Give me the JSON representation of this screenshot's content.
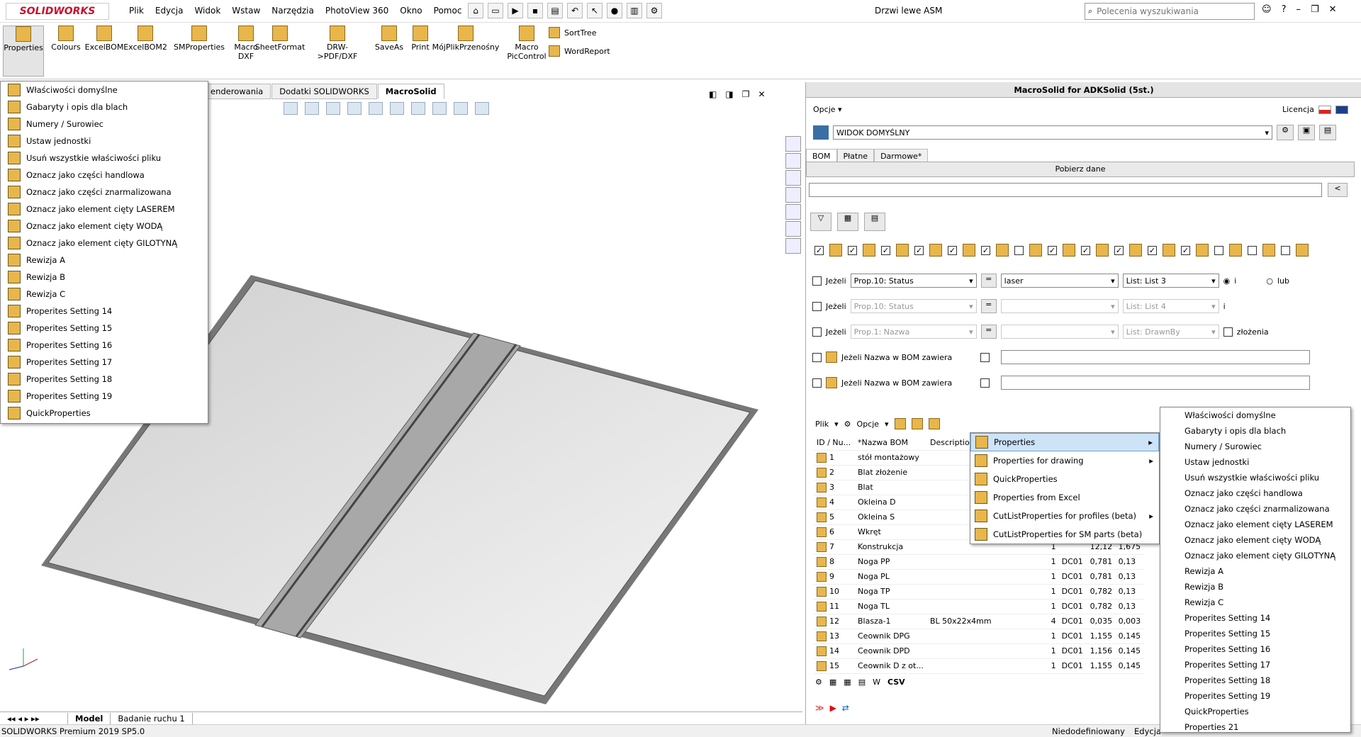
{
  "app": {
    "logo": "SOLIDWORKS",
    "window_title": "Drzwi lewe ASM"
  },
  "menu": [
    "Plik",
    "Edycja",
    "Widok",
    "Wstaw",
    "Narzędzia",
    "PhotoView 360",
    "Okno",
    "Pomoc"
  ],
  "search": {
    "placeholder": "Polecenia wyszukiwania"
  },
  "ribbon": {
    "buttons": [
      "Properties",
      "Colours",
      "ExcelBOM",
      "ExcelBOM2",
      "SMProperties",
      "Macro DXF",
      "SheetFormat",
      "DRW->PDF/DXF",
      "SaveAs",
      "Print",
      "MójPlikPrzenośny",
      "Macro PicControl"
    ],
    "small": [
      "SortTree",
      "WordReport"
    ]
  },
  "tabs": [
    "enderowania",
    "Dodatki SOLIDWORKS",
    "MacroSolid"
  ],
  "left_menu": [
    "Właściwości domyślne",
    "Gabaryty i opis dla blach",
    "Numery / Surowiec",
    "Ustaw jednostki",
    "Usuń wszystkie właściwości pliku",
    "Oznacz jako części handlowa",
    "Oznacz jako części znarmalizowana",
    "Oznacz jako element cięty LASEREM",
    "Oznacz jako element cięty WODĄ",
    "Oznacz jako element cięty GILOTYNĄ",
    "Rewizja A",
    "Rewizja B",
    "Rewizja C",
    "Properites Setting 14",
    "Properites Setting 15",
    "Properites Setting 16",
    "Properites Setting 17",
    "Properites Setting 18",
    "Properites Setting 19",
    "QuickProperties"
  ],
  "bottom_tabs": [
    "Model",
    "Badanie ruchu 1"
  ],
  "status": {
    "left": "SOLIDWORKS Premium 2019 SP5.0",
    "right1": "Niedodefiniowany",
    "right2": "Edycja"
  },
  "panel": {
    "title": "MacroSolid for ADKSolid (5st.)",
    "options": "Opcje",
    "license": "Licencja",
    "view": "WIDOK DOMYŚLNY",
    "tabs": [
      "BOM",
      "Płatne",
      "Darmowe*"
    ],
    "fetch": "Pobierz dane",
    "filter_rows": [
      {
        "label": "Jeżeli",
        "prop": "Prop.10: Status",
        "op": "=",
        "value": "laser",
        "list": "List: List 3",
        "tail": "i",
        "tail2": "lub"
      },
      {
        "label": "Jeżeli",
        "prop": "Prop.10: Status",
        "op": "=",
        "value": "",
        "list": "List: List 4",
        "tail": "i"
      },
      {
        "label": "Jeżeli",
        "prop": "Prop.1: Nazwa",
        "op": "=",
        "value": "",
        "list": "List: DrawnBy",
        "tail": "złożenia"
      }
    ],
    "name_rows": [
      "Jeżeli Nazwa w BOM zawiera",
      "Jeżeli Nazwa w BOM zawiera"
    ],
    "toolbar": {
      "file": "Plik",
      "options": "Opcje"
    },
    "csv": "CSV",
    "columns": [
      "ID / Nu...",
      "*Nazwa BOM",
      "Description"
    ],
    "rows": [
      {
        "id": "1",
        "name": "stół montażowy",
        "desc": "",
        "qty": "",
        "mat": "",
        "m1": "",
        "m2": ""
      },
      {
        "id": "2",
        "name": "Blat złożenie",
        "desc": "",
        "qty": "",
        "mat": "",
        "m1": "",
        "m2": ""
      },
      {
        "id": "3",
        "name": "Blat",
        "desc": "",
        "qty": "",
        "mat": "",
        "m1": "",
        "m2": ""
      },
      {
        "id": "4",
        "name": "Okleina D",
        "desc": "",
        "qty": "",
        "mat": "",
        "m1": "",
        "m2": ""
      },
      {
        "id": "5",
        "name": "Okleina S",
        "desc": "",
        "qty": "",
        "mat": "",
        "m1": "",
        "m2": ""
      },
      {
        "id": "6",
        "name": "Wkręt",
        "desc": "",
        "qty": "",
        "mat": "",
        "m1": "",
        "m2": ""
      },
      {
        "id": "7",
        "name": "Konstrukcja",
        "desc": "",
        "qty": "1",
        "mat": "",
        "m1": "12,12",
        "m2": "1,675"
      },
      {
        "id": "8",
        "name": "Noga PP",
        "desc": "",
        "qty": "1",
        "mat": "DC01",
        "m1": "0,781",
        "m2": "0,13"
      },
      {
        "id": "9",
        "name": "Noga PL",
        "desc": "",
        "qty": "1",
        "mat": "DC01",
        "m1": "0,781",
        "m2": "0,13"
      },
      {
        "id": "10",
        "name": "Noga TP",
        "desc": "",
        "qty": "1",
        "mat": "DC01",
        "m1": "0,782",
        "m2": "0,13"
      },
      {
        "id": "11",
        "name": "Noga TL",
        "desc": "",
        "qty": "1",
        "mat": "DC01",
        "m1": "0,782",
        "m2": "0,13"
      },
      {
        "id": "12",
        "name": "Blasza-1",
        "desc": "BL 50x22x4mm",
        "qty": "4",
        "mat": "DC01",
        "m1": "0,035",
        "m2": "0,003"
      },
      {
        "id": "13",
        "name": "Ceownik DPG",
        "desc": "",
        "qty": "1",
        "mat": "DC01",
        "m1": "1,155",
        "m2": "0,145"
      },
      {
        "id": "14",
        "name": "Ceownik DPD",
        "desc": "",
        "qty": "1",
        "mat": "DC01",
        "m1": "1,156",
        "m2": "0,145"
      },
      {
        "id": "15",
        "name": "Ceownik D z ot...",
        "desc": "",
        "qty": "1",
        "mat": "DC01",
        "m1": "1,155",
        "m2": "0,145"
      }
    ]
  },
  "popup_menu": [
    {
      "label": "Properties",
      "sub": true
    },
    {
      "label": "Properties for drawing",
      "sub": true
    },
    {
      "label": "QuickProperties",
      "sub": false
    },
    {
      "label": "Properties from Excel",
      "sub": false
    },
    {
      "label": "CutListProperties for profiles (beta)",
      "sub": true
    },
    {
      "label": "CutListProperties for SM parts (beta)",
      "sub": false
    }
  ],
  "submenu": [
    "Właściwości domyślne",
    "Gabaryty i opis dla blach",
    "Numery / Surowiec",
    "Ustaw jednostki",
    "Usuń wszystkie właściwości pliku",
    "Oznacz jako części handlowa",
    "Oznacz jako części znarmalizowana",
    "Oznacz jako element cięty LASEREM",
    "Oznacz jako element cięty WODĄ",
    "Oznacz jako element cięty GILOTYNĄ",
    "Rewizja A",
    "Rewizja B",
    "Rewizja C",
    "Properites Setting 14",
    "Properites Setting 15",
    "Properites Setting 16",
    "Properites Setting 17",
    "Properites Setting 18",
    "Properites Setting 19",
    "QuickProperties",
    "Properties 21"
  ],
  "colors": {
    "accent": "#cde3f7",
    "brand": "#c8102e",
    "icon": "#e8b64a"
  }
}
